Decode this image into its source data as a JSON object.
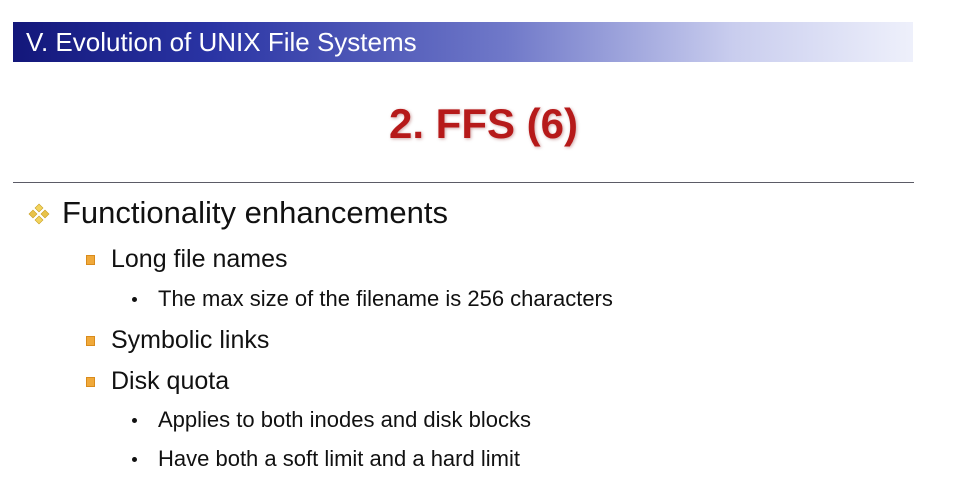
{
  "header": {
    "title": "V. Evolution of UNIX File Systems"
  },
  "slide": {
    "title": "2. FFS (6)"
  },
  "content": {
    "heading": "Functionality enhancements",
    "items": [
      {
        "label": "Long file names",
        "subitems": [
          "The max size of the filename is 256 characters"
        ]
      },
      {
        "label": "Symbolic links",
        "subitems": []
      },
      {
        "label": "Disk quota",
        "subitems": [
          "Applies to both inodes and disk blocks",
          "Have both a soft limit and a hard limit"
        ]
      }
    ]
  },
  "colors": {
    "header_gradient_start": "#13177a",
    "title_red": "#b61a1a",
    "bullet_gold": "#f0a93a",
    "diamond_bullet": "#e8c24a"
  },
  "icons": {
    "level1_bullet": "four-diamond-bullet-icon",
    "level2_bullet": "square-bullet-icon",
    "level3_bullet": "dot-bullet-icon"
  }
}
